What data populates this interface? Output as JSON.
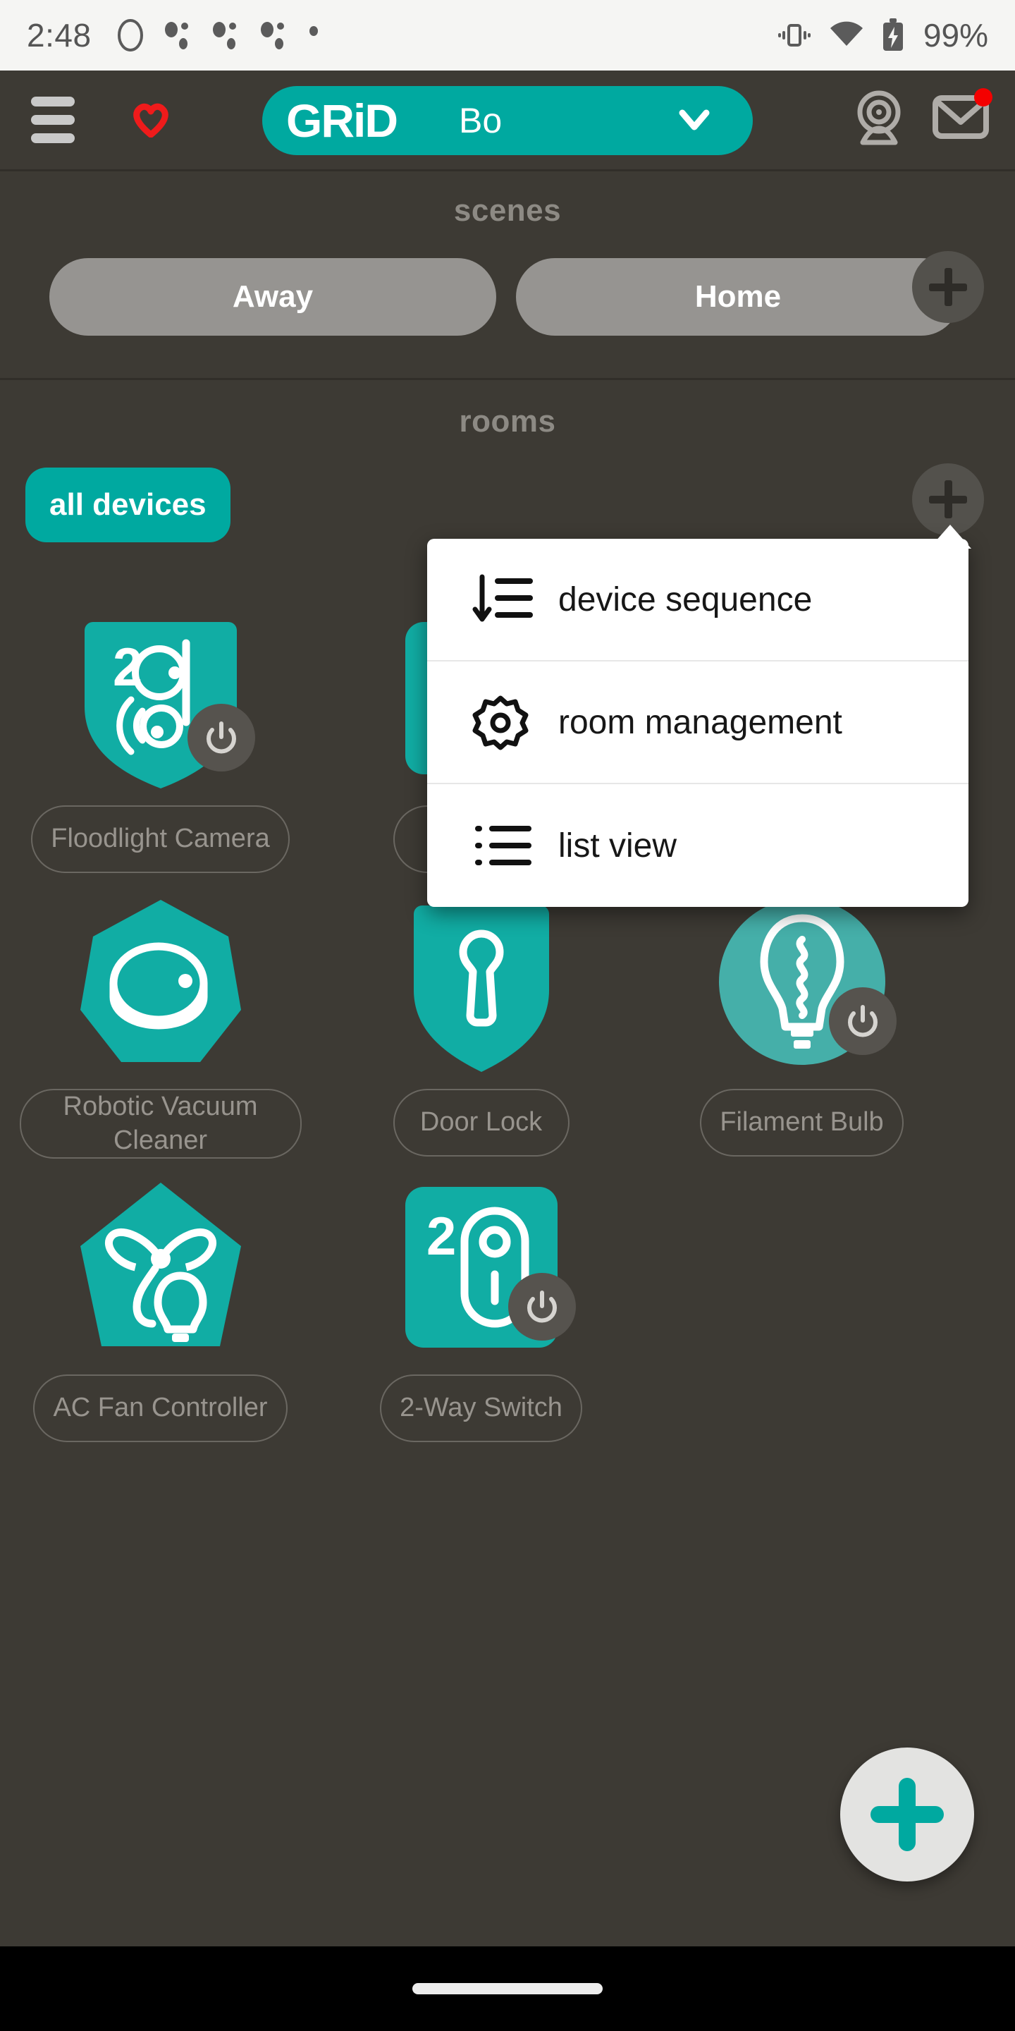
{
  "status_bar": {
    "time": "2:48",
    "battery_percent": "99%",
    "icons": [
      "circle-outline-icon",
      "notification-dots-icon",
      "notification-dots-icon",
      "notification-dots-icon",
      "small-dot-icon"
    ],
    "right_icons": [
      "vibrate-icon",
      "wifi-icon",
      "battery-charging-icon"
    ]
  },
  "app_bar": {
    "menu_icon": "hamburger-menu-icon",
    "favorite_icon": "heart-icon",
    "brand": "GRiD",
    "home_name": "Bo",
    "chevron_icon": "chevron-down-icon",
    "camera_icon": "webcam-icon",
    "mail_icon": "mail-icon",
    "has_mail_badge": true
  },
  "scenes": {
    "title": "scenes",
    "items": [
      {
        "label": "Away"
      },
      {
        "label": "Home"
      }
    ],
    "add_icon": "plus-icon"
  },
  "rooms": {
    "title": "rooms",
    "chips": [
      {
        "label": "all devices",
        "selected": true
      }
    ],
    "add_icon": "plus-icon"
  },
  "devices": [
    {
      "label": "Floodlight Camera",
      "shape": "shield",
      "icon": "floodlight-camera-icon",
      "has_power": true,
      "badge_number": "2"
    },
    {
      "label": "",
      "shape": "rounded-square",
      "icon": "hidden-device-icon",
      "has_power": false,
      "hidden_behind_menu": true
    },
    {
      "label": "",
      "shape": "rounded-square",
      "icon": "hidden-device-icon",
      "has_power": false,
      "hidden_behind_menu": true
    },
    {
      "label": "Robotic Vacuum Cleaner",
      "shape": "heptagon",
      "icon": "robot-vacuum-icon",
      "has_power": false
    },
    {
      "label": "Door Lock",
      "shape": "shield",
      "icon": "door-lock-icon",
      "has_power": false
    },
    {
      "label": "Filament Bulb",
      "shape": "circle",
      "icon": "filament-bulb-icon",
      "has_power": true
    },
    {
      "label": "AC Fan Controller",
      "shape": "pentagon",
      "icon": "fan-light-icon",
      "has_power": false
    },
    {
      "label": "2-Way Switch",
      "shape": "rounded-square",
      "icon": "two-way-switch-icon",
      "has_power": true,
      "badge_number": "2"
    }
  ],
  "popup_menu": {
    "items": [
      {
        "label": "device sequence",
        "icon": "sort-list-icon"
      },
      {
        "label": "room management",
        "icon": "gear-icon"
      },
      {
        "label": "list view",
        "icon": "bullet-list-icon"
      }
    ]
  },
  "fab": {
    "icon": "plus-icon",
    "label": "add device"
  },
  "colors": {
    "background": "#3D3A34",
    "accent_teal": "#00A9A0",
    "accent_teal_muted": "#3EAFA8",
    "scene_pill": "#969491",
    "label_text": "#98948E",
    "heading_text": "#8D8A84",
    "badge_red": "#F40000",
    "menu_bg": "#FFFFFF",
    "status_bar_bg": "#F5F5F3"
  }
}
